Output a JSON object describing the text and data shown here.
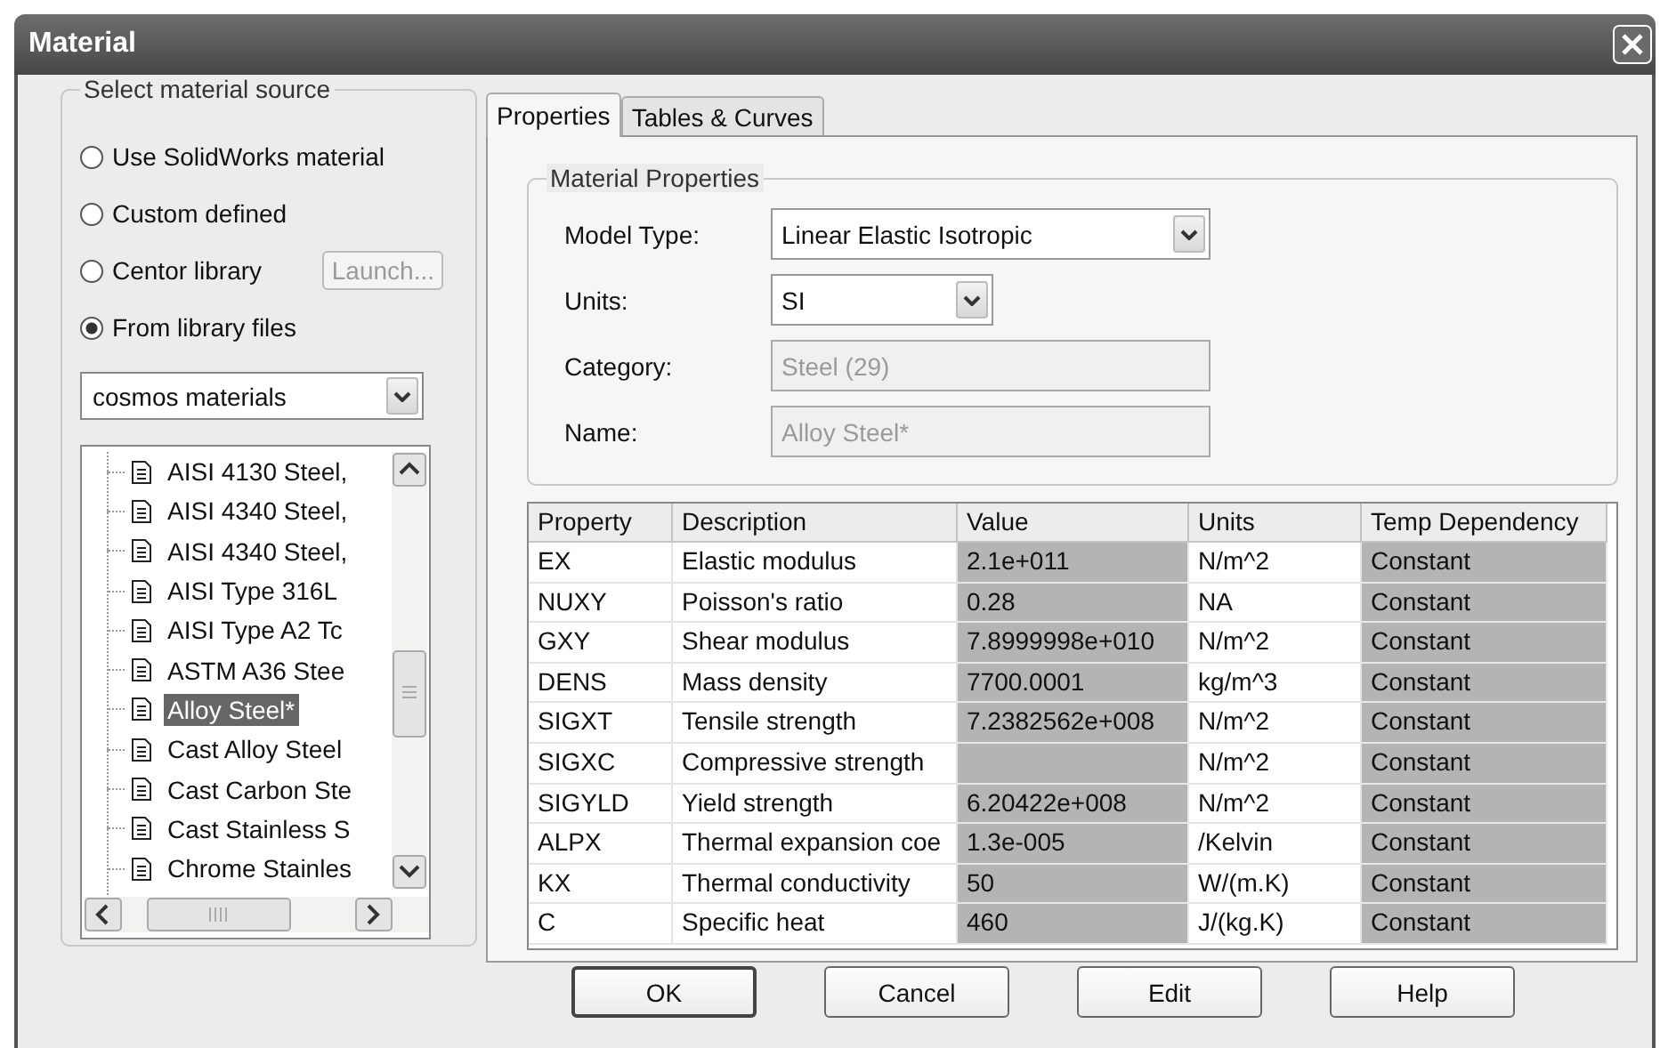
{
  "window": {
    "title": "Material"
  },
  "source": {
    "label": "Select material source",
    "options": [
      {
        "label": "Use SolidWorks material",
        "selected": false
      },
      {
        "label": "Custom defined",
        "selected": false
      },
      {
        "label": "Centor library",
        "selected": false,
        "button": {
          "label": "Launch...",
          "disabled": true
        }
      },
      {
        "label": "From library files",
        "selected": true
      }
    ],
    "library": {
      "value": "cosmos materials"
    },
    "tree": {
      "items": [
        {
          "label": "AISI 4130 Steel,",
          "selected": false
        },
        {
          "label": "AISI 4340 Steel,",
          "selected": false
        },
        {
          "label": "AISI 4340 Steel,",
          "selected": false
        },
        {
          "label": "AISI Type 316L",
          "selected": false
        },
        {
          "label": "AISI Type A2 Tc",
          "selected": false
        },
        {
          "label": "ASTM A36 Stee",
          "selected": false
        },
        {
          "label": "Alloy Steel*",
          "selected": true
        },
        {
          "label": "Cast Alloy Steel",
          "selected": false
        },
        {
          "label": "Cast Carbon Ste",
          "selected": false
        },
        {
          "label": "Cast Stainless S",
          "selected": false
        },
        {
          "label": "Chrome Stainles",
          "selected": false
        }
      ]
    }
  },
  "tabs": [
    {
      "label": "Properties",
      "selected": true
    },
    {
      "label": "Tables & Curves",
      "selected": false
    }
  ],
  "material_properties": {
    "label": "Material Properties",
    "fields": [
      {
        "label": "Model Type:",
        "value": "Linear Elastic Isotropic",
        "kind": "dropdown",
        "disabled": false
      },
      {
        "label": "Units:",
        "value": "SI",
        "kind": "dropdown-short",
        "disabled": false
      },
      {
        "label": "Category:",
        "value": "Steel (29)",
        "kind": "text",
        "disabled": true
      },
      {
        "label": "Name:",
        "value": "Alloy Steel*",
        "kind": "text",
        "disabled": true
      }
    ]
  },
  "table": {
    "columns": [
      "Property",
      "Description",
      "Value",
      "Units",
      "Temp Dependency"
    ],
    "rows": [
      {
        "property": "EX",
        "description": "Elastic modulus",
        "value": "2.1e+011",
        "units": "N/m^2",
        "temp_dependency": "Constant"
      },
      {
        "property": "NUXY",
        "description": "Poisson's ratio",
        "value": "0.28",
        "units": "NA",
        "temp_dependency": "Constant"
      },
      {
        "property": "GXY",
        "description": "Shear modulus",
        "value": "7.8999998e+010",
        "units": "N/m^2",
        "temp_dependency": "Constant"
      },
      {
        "property": "DENS",
        "description": "Mass density",
        "value": "7700.0001",
        "units": "kg/m^3",
        "temp_dependency": "Constant"
      },
      {
        "property": "SIGXT",
        "description": "Tensile strength",
        "value": "7.2382562e+008",
        "units": "N/m^2",
        "temp_dependency": "Constant"
      },
      {
        "property": "SIGXC",
        "description": "Compressive strength",
        "units": "N/m^2",
        "temp_dependency": "Constant"
      },
      {
        "property": "SIGYLD",
        "description": "Yield strength",
        "value": "6.20422e+008",
        "units": "N/m^2",
        "temp_dependency": "Constant"
      },
      {
        "property": "ALPX",
        "description": "Thermal expansion coe",
        "value": "1.3e-005",
        "units": "/Kelvin",
        "temp_dependency": "Constant"
      },
      {
        "property": "KX",
        "description": "Thermal conductivity",
        "value": "50",
        "units": "W/(m.K)",
        "temp_dependency": "Constant"
      },
      {
        "property": "C",
        "description": "Specific heat",
        "value": "460",
        "units": "J/(kg.K)",
        "temp_dependency": "Constant"
      }
    ]
  },
  "buttons": [
    {
      "label": "OK",
      "default": true
    },
    {
      "label": "Cancel",
      "default": false
    },
    {
      "label": "Edit",
      "default": false
    },
    {
      "label": "Help",
      "default": false
    }
  ]
}
